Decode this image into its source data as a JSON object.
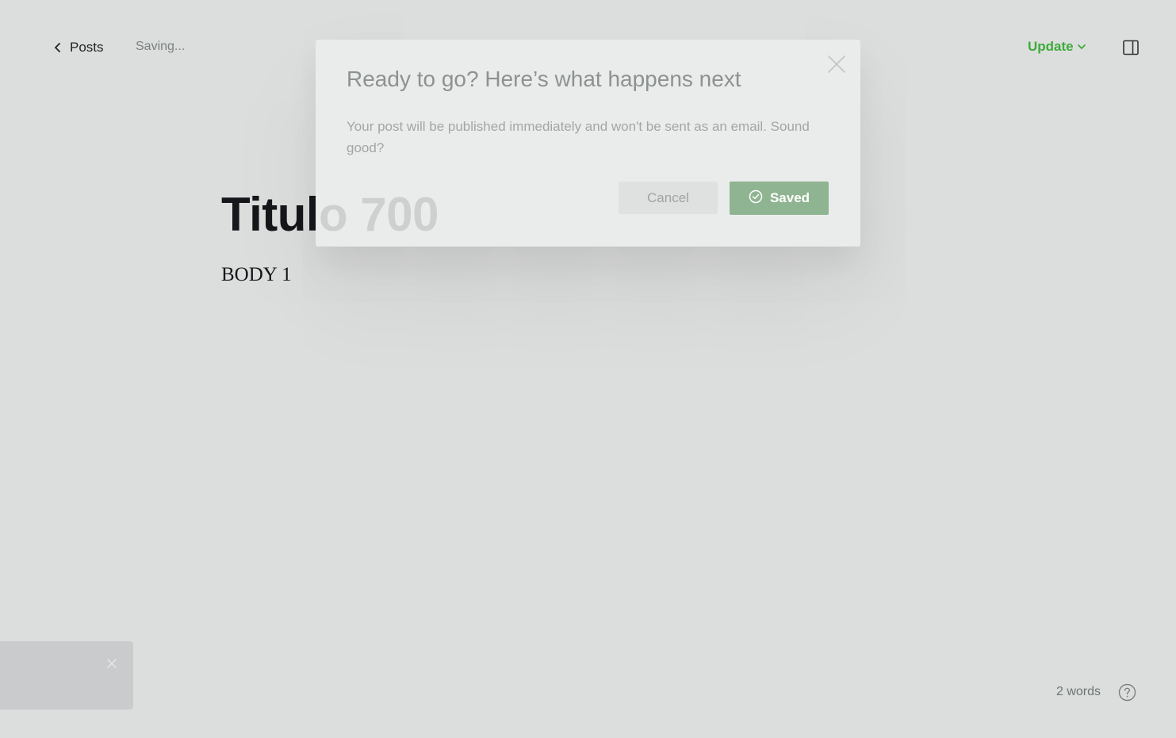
{
  "header": {
    "back_label": "Posts",
    "save_status": "Saving...",
    "update_label": "Update"
  },
  "editor": {
    "title": "Titulo 700",
    "body": "BODY 1"
  },
  "modal": {
    "title": "Ready to go? Here’s what happens next",
    "message": "Your post will be published immediately and won't be sent as an email. Sound good?",
    "cancel_label": "Cancel",
    "confirm_label": "Saved"
  },
  "footer": {
    "word_count": "2 words"
  },
  "icons": {
    "back": "chevron-left-icon",
    "update_dropdown": "chevron-down-icon",
    "sidebar": "sidebar-toggle-icon",
    "modal_close": "close-icon",
    "saved": "check-circle-icon",
    "toast_close": "close-icon",
    "help": "help-icon"
  },
  "colors": {
    "accent_green": "#3eab3a",
    "saved_button": "#8fb491",
    "background": "#dcdedd",
    "text_dark": "#15171a"
  }
}
